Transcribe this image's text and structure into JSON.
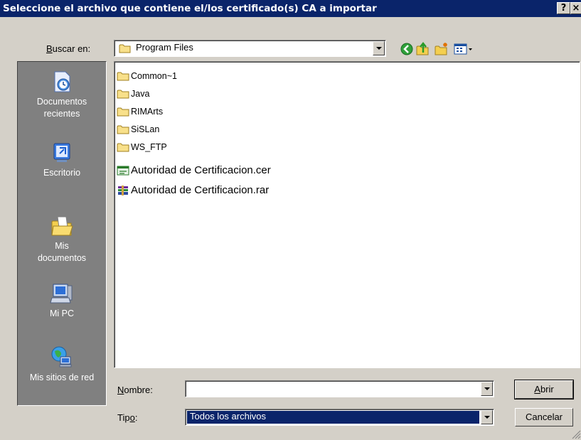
{
  "window": {
    "title": "Seleccione el archivo que contiene el/los certificado(s) CA a importar",
    "help_label": "?",
    "close_label": "×"
  },
  "lookin": {
    "label_u": "B",
    "label_rest": "uscar en:",
    "value": "Program Files"
  },
  "toolbar": {
    "icons": [
      "back-icon",
      "up-folder-icon",
      "new-folder-icon",
      "view-menu-icon"
    ]
  },
  "places": [
    {
      "id": "documentos-recientes",
      "label": "Documentos\nrecientes",
      "icon": "recent-documents-icon"
    },
    {
      "id": "escritorio",
      "label": "Escritorio",
      "icon": "desktop-icon"
    },
    {
      "id": "mis-documentos",
      "label": "Mis\ndocumentos",
      "icon": "my-documents-icon"
    },
    {
      "id": "mi-pc",
      "label": "Mi PC",
      "icon": "my-computer-icon"
    },
    {
      "id": "mis-sitios-de-red",
      "label": "Mis sitios de red",
      "icon": "network-places-icon"
    }
  ],
  "files": [
    {
      "name": "Common~1",
      "type": "folder"
    },
    {
      "name": "Java",
      "type": "folder"
    },
    {
      "name": "RIMArts",
      "type": "folder"
    },
    {
      "name": "SiSLan",
      "type": "folder"
    },
    {
      "name": "WS_FTP",
      "type": "folder"
    },
    {
      "name": "Autoridad de Certificacion.cer",
      "type": "certificate"
    },
    {
      "name": "Autoridad de Certificacion.rar",
      "type": "rar"
    }
  ],
  "filename": {
    "label_u": "N",
    "label_rest": "ombre:",
    "value": ""
  },
  "filetype": {
    "label_pre": "Tip",
    "label_u": "o",
    "label_rest": ":",
    "value": "Todos los archivos"
  },
  "buttons": {
    "open_u": "A",
    "open_rest": "brir",
    "cancel": "Cancelar"
  }
}
